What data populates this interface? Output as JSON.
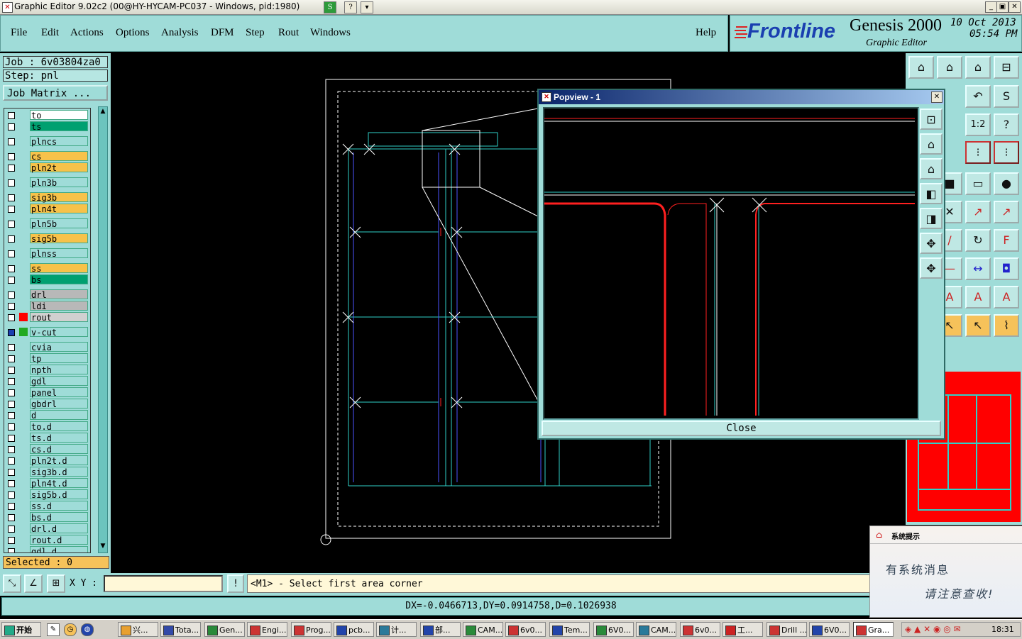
{
  "window": {
    "title": "Graphic Editor 9.02c2 (00@HY-HYCAM-PC037 - Windows, pid:1980)",
    "app_icon": "app-x-icon",
    "min_glyph": "_",
    "max_glyph": "▣",
    "close_glyph": "✕"
  },
  "menus": [
    "File",
    "Edit",
    "Actions",
    "Options",
    "Analysis",
    "DFM",
    "Step",
    "Rout",
    "Windows"
  ],
  "help_label": "Help",
  "brand": {
    "logo": "Frontline",
    "product": "Genesis 2000",
    "subtitle": "Graphic Editor",
    "date": "10 Oct 2013",
    "time": "05:54 PM"
  },
  "job": {
    "label": "Job : 6v03804za0",
    "step": "Step: pnl",
    "matrix_button": "Job Matrix ..."
  },
  "layers": [
    {
      "name": "to",
      "color": "#ffffff",
      "swatch": ""
    },
    {
      "name": "ts",
      "color": "#00a070",
      "swatch": ""
    },
    {
      "name": "plncs",
      "color": "#9fdcd8",
      "swatch": ""
    },
    {
      "name": "cs",
      "color": "#f7c24a",
      "swatch": ""
    },
    {
      "name": "pln2t",
      "color": "#f7c24a",
      "swatch": ""
    },
    {
      "name": "pln3b",
      "color": "#9fdcd8",
      "swatch": ""
    },
    {
      "name": "sig3b",
      "color": "#f7c24a",
      "swatch": ""
    },
    {
      "name": "pln4t",
      "color": "#f7c24a",
      "swatch": ""
    },
    {
      "name": "pln5b",
      "color": "#9fdcd8",
      "swatch": ""
    },
    {
      "name": "sig5b",
      "color": "#f7c24a",
      "swatch": ""
    },
    {
      "name": "plnss",
      "color": "#9fdcd8",
      "swatch": ""
    },
    {
      "name": "ss",
      "color": "#f7c24a",
      "swatch": ""
    },
    {
      "name": "bs",
      "color": "#00a070",
      "swatch": ""
    },
    {
      "name": "drl",
      "color": "#b8b8b8",
      "swatch": ""
    },
    {
      "name": "ldi",
      "color": "#b8b8b8",
      "swatch": ""
    },
    {
      "name": "rout",
      "color": "#d0d0d0",
      "swatch": "#ff0000"
    },
    {
      "name": "v-cut",
      "color": "#9fdcd8",
      "swatch": "#22aa22"
    },
    {
      "name": "cvia",
      "color": "#9fdcd8",
      "swatch": ""
    },
    {
      "name": "tp",
      "color": "#9fdcd8",
      "swatch": ""
    },
    {
      "name": "npth",
      "color": "#9fdcd8",
      "swatch": ""
    },
    {
      "name": "gdl",
      "color": "#9fdcd8",
      "swatch": ""
    },
    {
      "name": "panel",
      "color": "#9fdcd8",
      "swatch": ""
    },
    {
      "name": "gbdrl",
      "color": "#9fdcd8",
      "swatch": ""
    },
    {
      "name": "d",
      "color": "#9fdcd8",
      "swatch": ""
    },
    {
      "name": "to.d",
      "color": "#9fdcd8",
      "swatch": ""
    },
    {
      "name": "ts.d",
      "color": "#9fdcd8",
      "swatch": ""
    },
    {
      "name": "cs.d",
      "color": "#9fdcd8",
      "swatch": ""
    },
    {
      "name": "pln2t.d",
      "color": "#9fdcd8",
      "swatch": ""
    },
    {
      "name": "sig3b.d",
      "color": "#9fdcd8",
      "swatch": ""
    },
    {
      "name": "pln4t.d",
      "color": "#9fdcd8",
      "swatch": ""
    },
    {
      "name": "sig5b.d",
      "color": "#9fdcd8",
      "swatch": ""
    },
    {
      "name": "ss.d",
      "color": "#9fdcd8",
      "swatch": ""
    },
    {
      "name": "bs.d",
      "color": "#9fdcd8",
      "swatch": ""
    },
    {
      "name": "drl.d",
      "color": "#9fdcd8",
      "swatch": ""
    },
    {
      "name": "rout.d",
      "color": "#9fdcd8",
      "swatch": ""
    },
    {
      "name": "gdl.d",
      "color": "#9fdcd8",
      "swatch": ""
    }
  ],
  "selected": "Selected : 0",
  "popview": {
    "title": "Popview - 1",
    "close_label": "Close",
    "close_glyph": "✕"
  },
  "command": {
    "xy_label": "X Y :",
    "xy_value": "",
    "prompt": "<M1> - Select first area corner",
    "info_glyph": "!"
  },
  "status": "DX=-0.0466713,DY=0.0914758,D=0.1026938",
  "notification": {
    "title": "系统提示",
    "line1": "有系统消息",
    "line2": "请注意查收!"
  },
  "taskbar": {
    "start": "开始",
    "items": [
      "兴...",
      "Tota...",
      "Gen...",
      "Engi...",
      "Prog...",
      "pcb...",
      "计...",
      "部...",
      "CAM...",
      "6v0...",
      "Tem...",
      "6V0...",
      "CAM...",
      "6v0...",
      "工...",
      "Drill ...",
      "6V0...",
      "Gra..."
    ],
    "clock": "18:31"
  },
  "colors": {
    "panel": "#9fdcd8",
    "accent": "#f7c24a",
    "rout": "#ff0000",
    "vcut": "#22aa22"
  }
}
